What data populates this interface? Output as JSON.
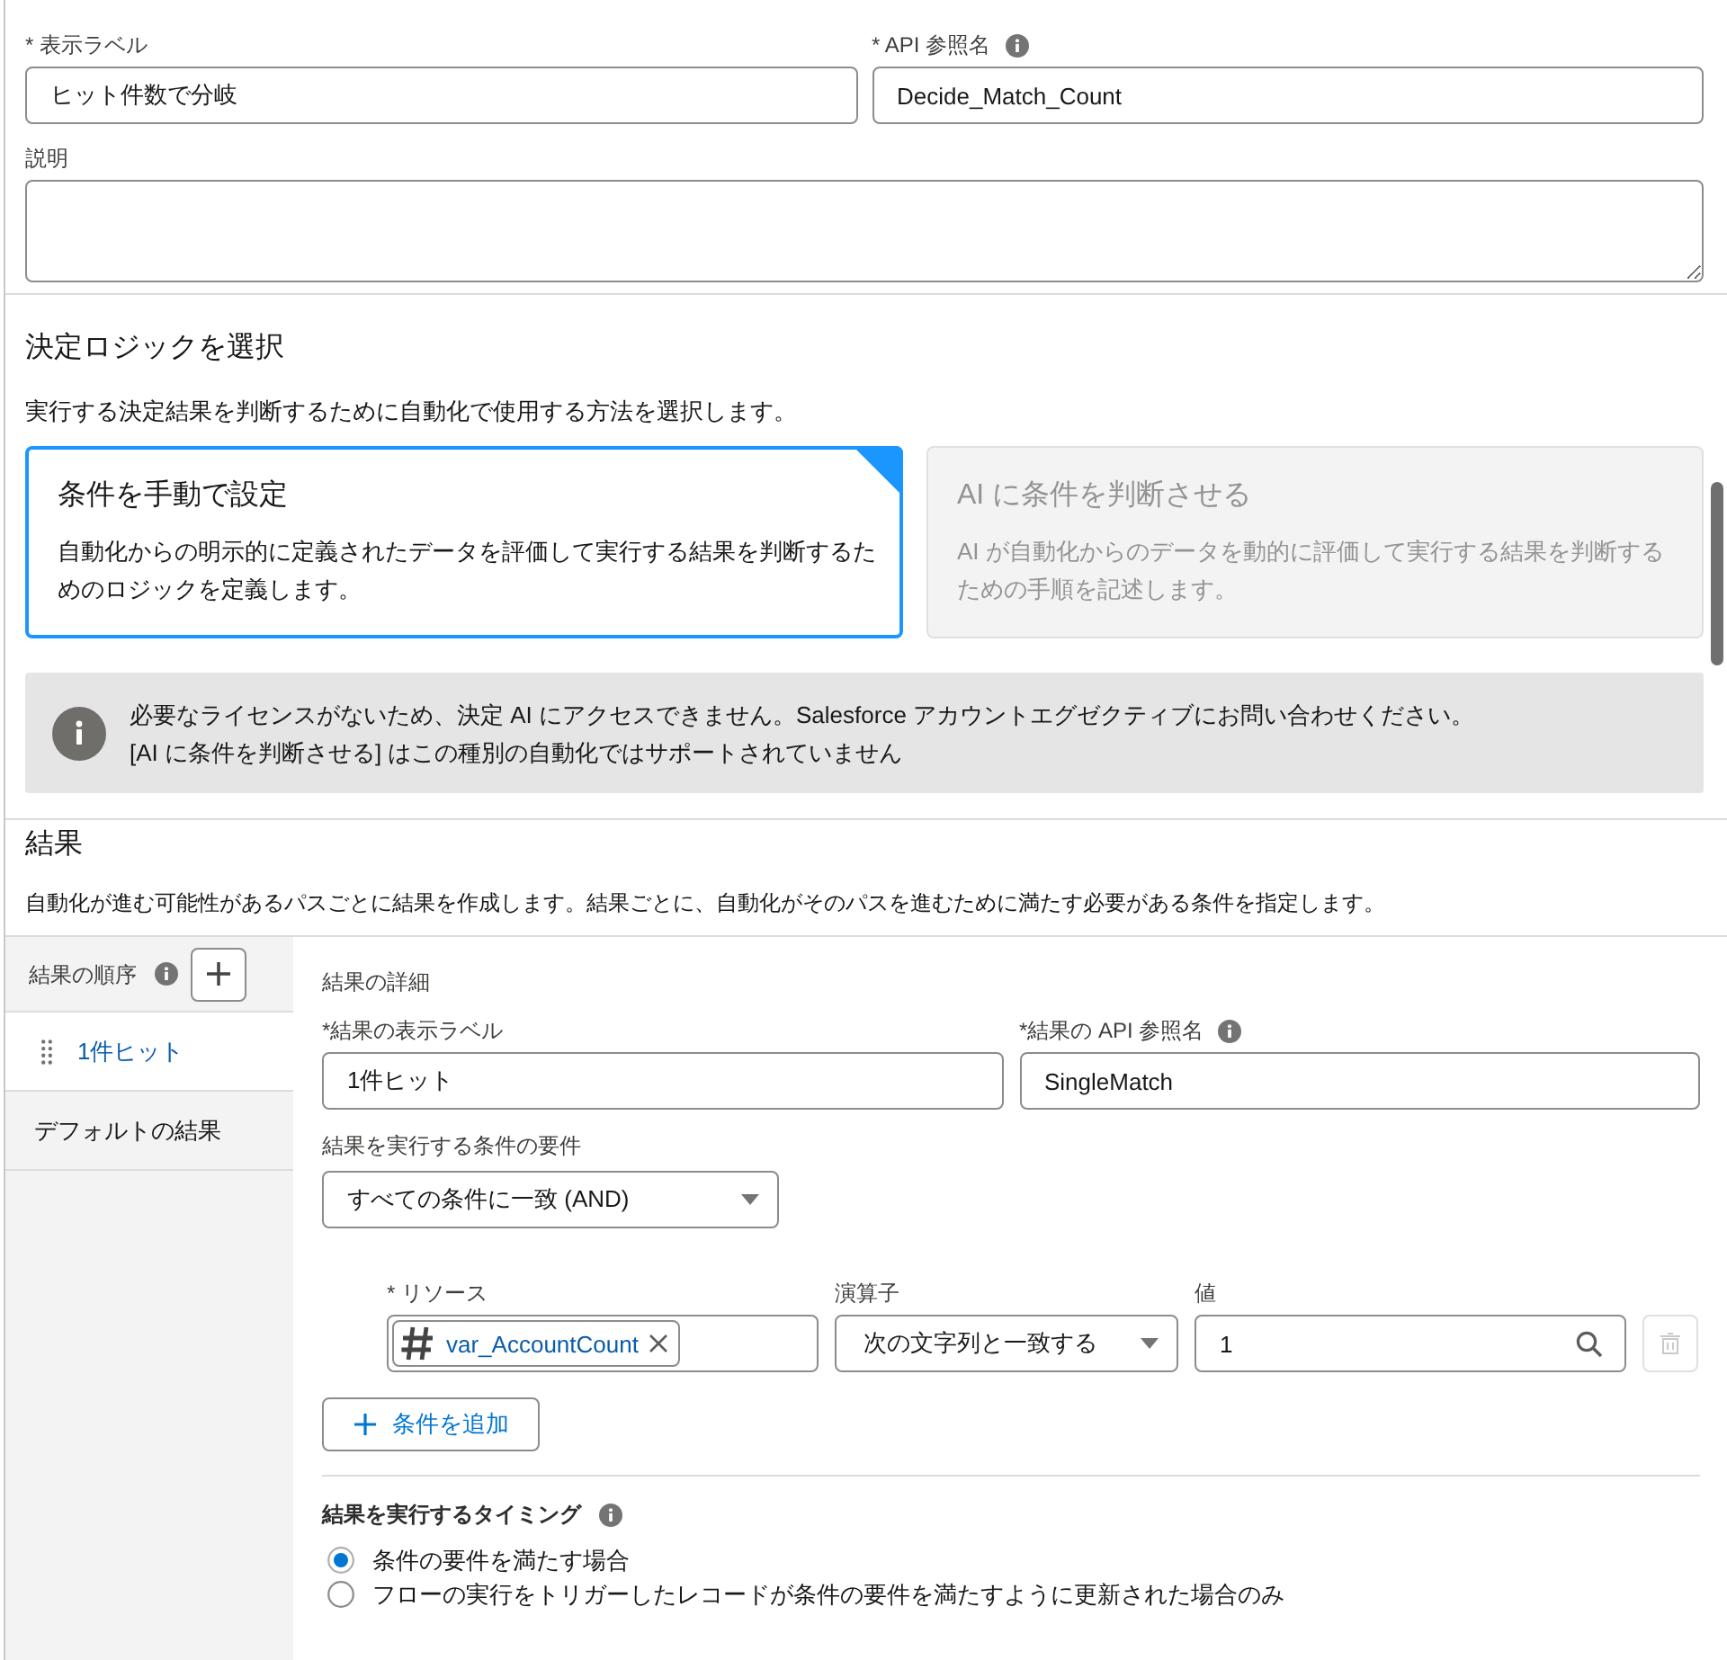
{
  "fields": [
    {
      "label": "* 表示ラベル",
      "value": "ヒット件数で分岐",
      "info": false
    },
    {
      "label": "* API 参照名",
      "value": "Decide_Match_Count",
      "info": true
    }
  ],
  "description_field": {
    "label": "説明"
  },
  "decision_logic": {
    "title": "決定ロジックを選択",
    "description": "実行する決定結果を判断するために自動化で使用する方法を選択します。",
    "options": [
      {
        "title": "条件を手動で設定",
        "description": "自動化からの明示的に定義されたデータを評価して実行する結果を判断するためのロジックを定義します。",
        "selected": true,
        "disabled": false
      },
      {
        "title": "AI に条件を判断させる",
        "description": "AI が自動化からのデータを動的に評価して実行する結果を判断するための手順を記述します。",
        "selected": false,
        "disabled": true
      }
    ],
    "notice": {
      "lines": [
        "必要なライセンスがないため、決定 AI にアクセスできません。Salesforce アカウントエグゼクティブにお問い合わせください。",
        "[AI に条件を判断させる] はこの種別の自動化ではサポートされていません"
      ]
    }
  },
  "outcomes": {
    "title": "結果",
    "description": "自動化が進む可能性があるパスごとに結果を作成します。結果ごとに、自動化がそのパスを進むために満たす必要がある条件を指定します。",
    "order": {
      "label": "結果の順序",
      "info": true
    },
    "items": [
      {
        "label": "1件ヒット",
        "selected": true,
        "draggable": true
      },
      {
        "label": "デフォルトの結果",
        "selected": false,
        "draggable": false
      }
    ],
    "detail": {
      "title": "結果の詳細",
      "fields": [
        {
          "label": "*結果の表示ラベル",
          "value": "1件ヒット",
          "info": false
        },
        {
          "label": "*結果の API 参照名",
          "value": "SingleMatch",
          "info": true
        }
      ],
      "requirement": {
        "label": "結果を実行する条件の要件",
        "value": "すべての条件に一致 (AND)"
      },
      "conditions": [
        {
          "resource_label": "* リソース",
          "resource": "var_AccountCount",
          "operator_label": "演算子",
          "operator": "次の文字列と一致する",
          "value_label": "値",
          "value": "1",
          "delete_disabled": true
        }
      ],
      "add_condition": "条件を追加",
      "timing": {
        "label": "結果を実行するタイミング",
        "info": true,
        "options": [
          {
            "label": "条件の要件を満たす場合",
            "selected": true
          },
          {
            "label": "フローの実行をトリガーしたレコードが条件の要件を満たすように更新された場合のみ",
            "selected": false
          }
        ]
      }
    }
  }
}
